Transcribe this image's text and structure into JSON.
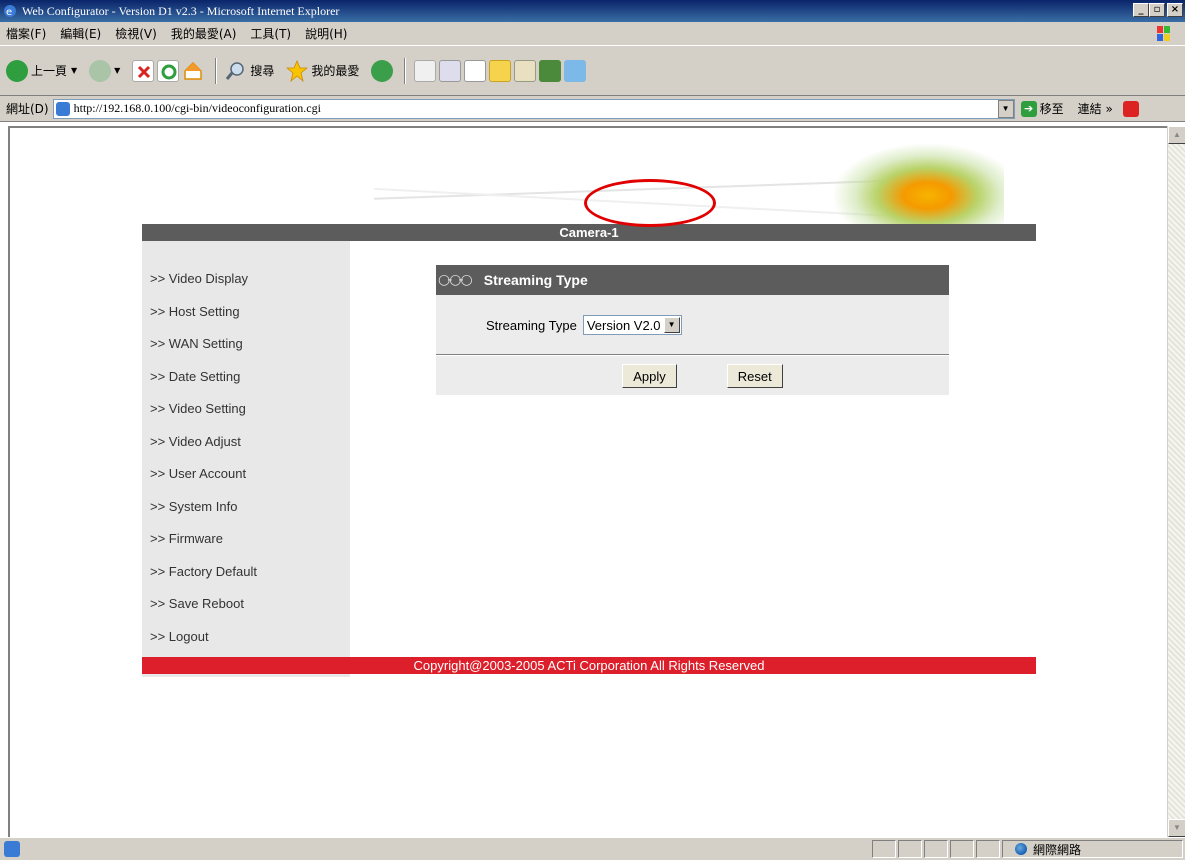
{
  "window": {
    "title": "Web Configurator - Version D1 v2.3 - Microsoft Internet Explorer"
  },
  "menubar": {
    "items": [
      "檔案(F)",
      "編輯(E)",
      "檢視(V)",
      "我的最愛(A)",
      "工具(T)",
      "說明(H)"
    ]
  },
  "toolbar": {
    "back": "上一頁",
    "search": "搜尋",
    "favorites": "我的最愛"
  },
  "address": {
    "label": "網址(D)",
    "url": "http://192.168.0.100/cgi-bin/videoconfiguration.cgi",
    "go": "移至",
    "links": "連結"
  },
  "page": {
    "camera_name": "Camera-1",
    "sidebar": [
      ">> Video Display",
      ">> Host Setting",
      ">> WAN Setting",
      ">> Date Setting",
      ">> Video Setting",
      ">> Video Adjust",
      ">> User Account",
      ">> System Info",
      ">> Firmware",
      ">> Factory Default",
      ">> Save Reboot",
      ">> Logout"
    ],
    "panel": {
      "title": "Streaming Type",
      "field_label": "Streaming Type",
      "selected_value": "Version V2.0",
      "apply_label": "Apply",
      "reset_label": "Reset"
    },
    "copyright": "Copyright@2003-2005 ACTi Corporation All Rights Reserved"
  },
  "statusbar": {
    "zone": "網際網路"
  },
  "colors": {
    "header_gray": "#5c5c5c",
    "footer_red": "#dc1f2a",
    "highlight_oval": "#e00000"
  }
}
